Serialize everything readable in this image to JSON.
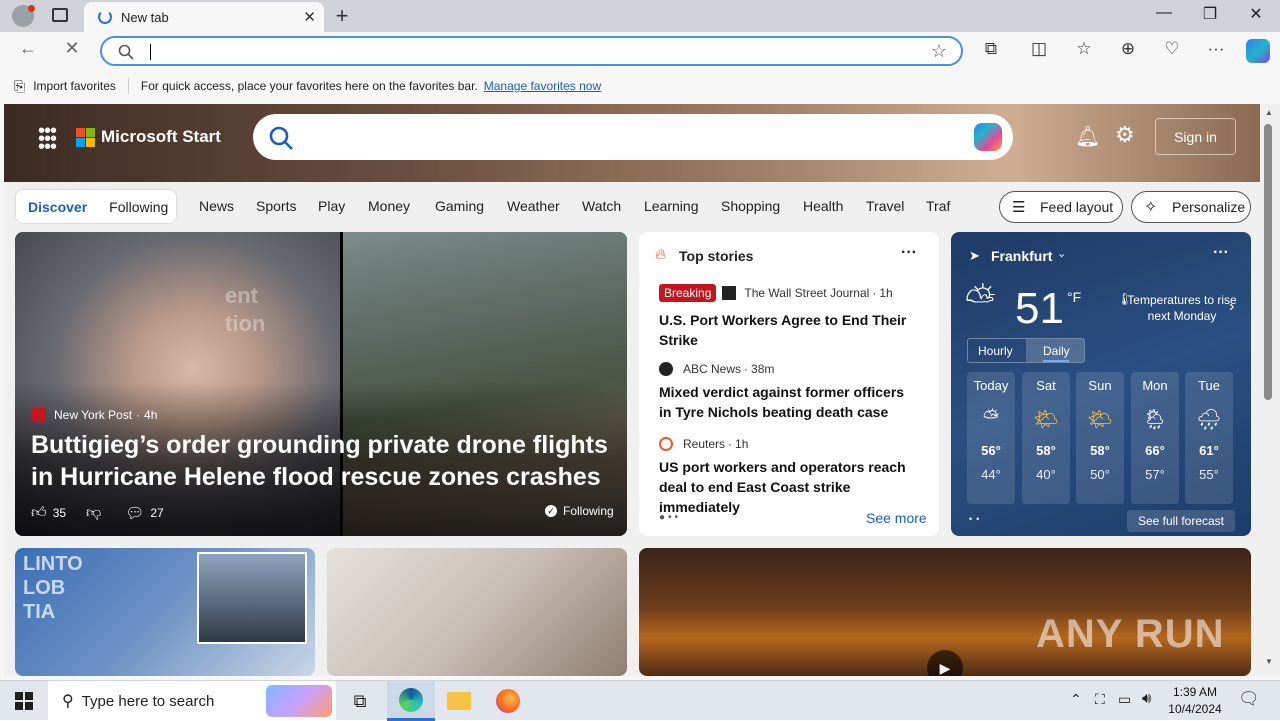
{
  "browser": {
    "tab_title": "New tab",
    "address_value": "",
    "favbar": {
      "import_label": "Import favorites",
      "hint": "For quick access, place your favorites here on the favorites bar.",
      "manage_link": "Manage favorites now"
    }
  },
  "page": {
    "brand": "Microsoft Start",
    "sign_in": "Sign in",
    "tabs": [
      "Discover",
      "Following"
    ],
    "categories": [
      "News",
      "Sports",
      "Play",
      "Money",
      "Gaming",
      "Weather",
      "Watch",
      "Learning",
      "Shopping",
      "Health",
      "Travel",
      "Traf"
    ],
    "feed_layout": "Feed layout",
    "personalize": "Personalize",
    "big_card": {
      "source": "New York Post",
      "age": "4h",
      "title": "Buttigieg’s order grounding private drone flights in Hurricane Helene flood rescue zones crashes and…",
      "likes": "35",
      "comments": "27",
      "following": "Following"
    },
    "top_stories": {
      "heading": "Top stories",
      "breaking": "Breaking",
      "stories": [
        {
          "source": "The Wall Street Journal",
          "age": "1h",
          "title": "U.S. Port Workers Agree to End Their Strike"
        },
        {
          "source": "ABC News",
          "age": "38m",
          "title": "Mixed verdict against former officers in Tyre Nichols beating death case"
        },
        {
          "source": "Reuters",
          "age": "1h",
          "title": "US port workers and operators reach deal to end East Coast strike immediately"
        }
      ],
      "see_more": "See more"
    },
    "weather": {
      "location": "Frankfurt",
      "temp": "51",
      "unit": "°F",
      "note": "Temperatures to rise next Monday",
      "toggle": [
        "Hourly",
        "Daily"
      ],
      "forecast": [
        {
          "day": "Today",
          "hi": "56°",
          "lo": "44°",
          "icon": "partly-cloudy-icon"
        },
        {
          "day": "Sat",
          "hi": "58°",
          "lo": "40°",
          "icon": "partly-sunny-icon"
        },
        {
          "day": "Sun",
          "hi": "58°",
          "lo": "50°",
          "icon": "partly-sunny-icon"
        },
        {
          "day": "Mon",
          "hi": "66°",
          "lo": "57°",
          "icon": "rain-sun-icon"
        },
        {
          "day": "Tue",
          "hi": "61°",
          "lo": "55°",
          "icon": "rain-icon"
        }
      ],
      "see_full": "See full forecast"
    },
    "watermark": "ANY RUN"
  },
  "taskbar": {
    "search_placeholder": "Type here to search",
    "time": "1:39 AM",
    "date": "10/4/2024"
  }
}
